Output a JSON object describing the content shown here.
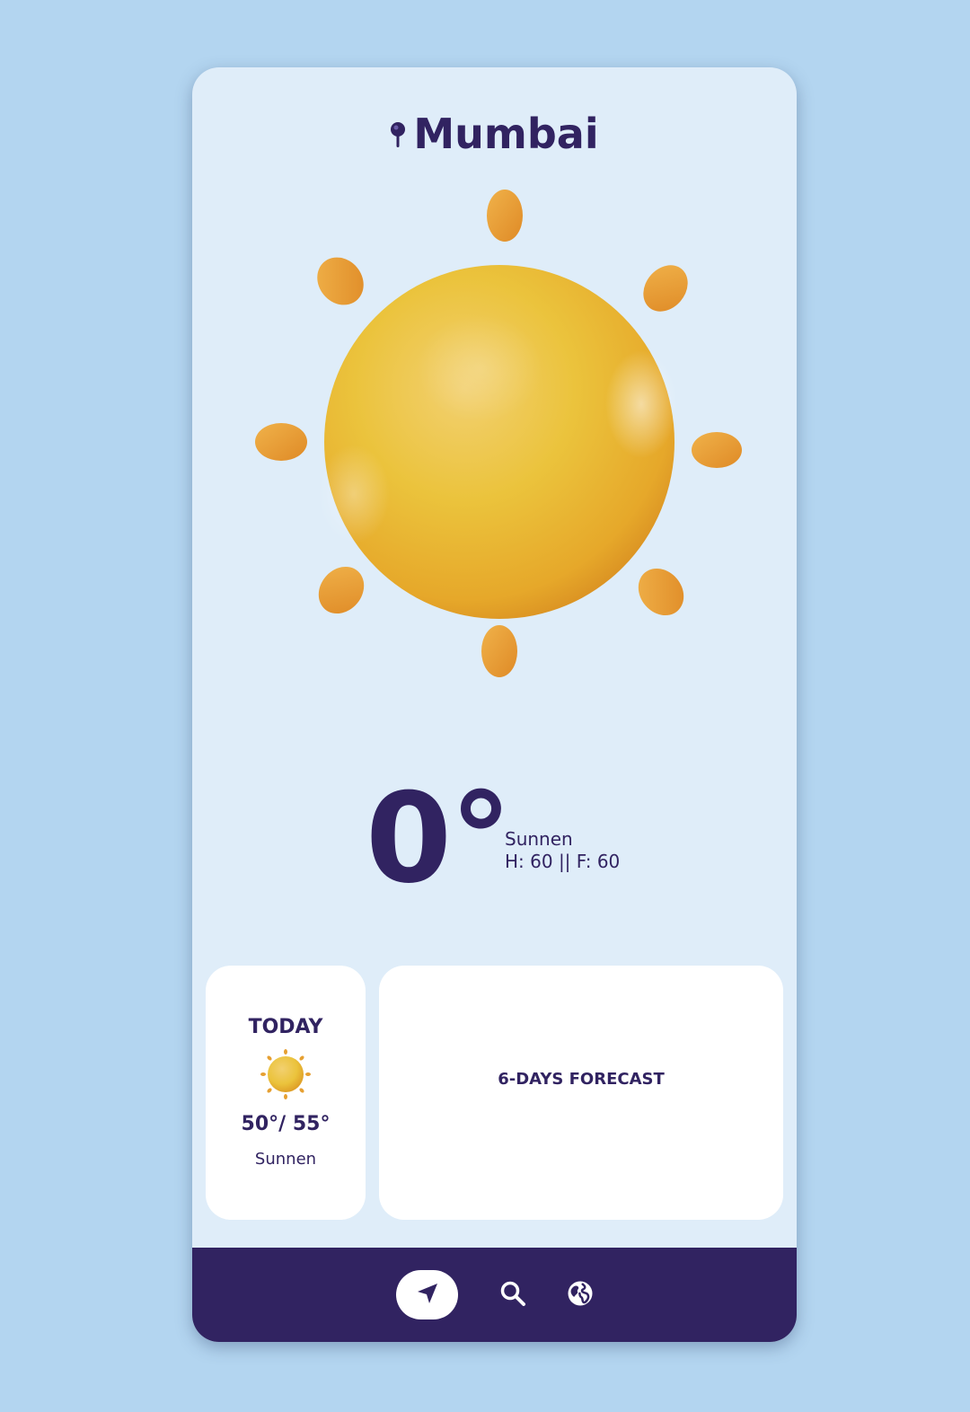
{
  "location": {
    "city": "Mumbai",
    "icon": "map-pin-icon"
  },
  "current": {
    "temperature": "0°",
    "condition": "Sunnen",
    "high_low": "H: 60 || F: 60",
    "icon": "sun-icon"
  },
  "today": {
    "label": "TODAY",
    "icon": "sun-icon",
    "temps": "50°/ 55°",
    "condition": "Sunnen"
  },
  "forecast": {
    "title": "6-DAYS FORECAST"
  },
  "nav": {
    "items": [
      {
        "icon": "location-arrow-icon",
        "active": true
      },
      {
        "icon": "search-icon",
        "active": false
      },
      {
        "icon": "globe-icon",
        "active": false
      }
    ]
  },
  "colors": {
    "background": "#b3d5f0",
    "card": "#dfedf9",
    "accent": "#312361",
    "sun": "#eab530",
    "ray": "#e89a2c"
  }
}
